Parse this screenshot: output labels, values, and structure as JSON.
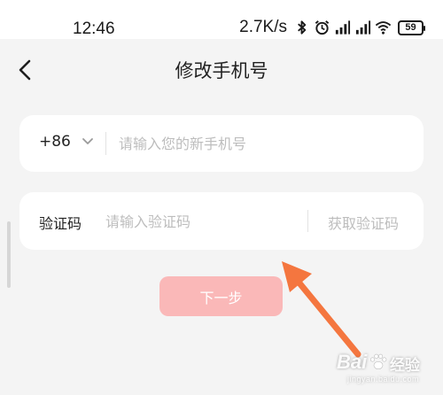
{
  "status_bar": {
    "time": "12:46",
    "net_speed": "2.7K/s",
    "battery": "59",
    "icons": [
      "bluetooth-icon",
      "alarm-icon",
      "signal-icon",
      "signal-icon",
      "wifi-icon",
      "battery-icon"
    ]
  },
  "header": {
    "title": "修改手机号",
    "back_icon": "chevron-left-icon"
  },
  "phone_field": {
    "country_code": "+86",
    "dropdown_icon": "chevron-down-icon",
    "placeholder": "请输入您的新手机号",
    "value": ""
  },
  "code_field": {
    "label": "验证码",
    "placeholder": "请输入验证码",
    "value": "",
    "get_code_label": "获取验证码"
  },
  "next_button": {
    "label": "下一步"
  },
  "colors": {
    "background": "#f4f4f4",
    "card": "#ffffff",
    "button_disabled": "#fab8b8",
    "annotation_arrow": "#f4763f",
    "placeholder": "#bdbdbd"
  },
  "watermark": {
    "brand": "Bai",
    "suffix": "经验",
    "url": "jingyan.baidu.com"
  }
}
